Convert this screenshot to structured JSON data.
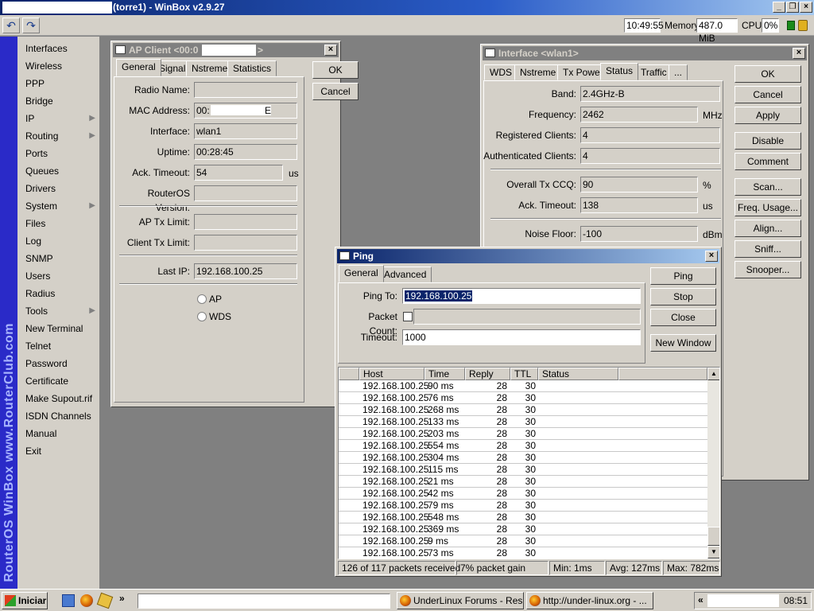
{
  "app": {
    "title": "(torre1) - WinBox v2.9.27"
  },
  "toolbar": {
    "time": "10:49:55",
    "memory_label": "Memory:",
    "memory_value": "487.0 MiB",
    "cpu_label": "CPU:",
    "cpu_value": "0%"
  },
  "sidebar": {
    "brand": "RouterOS WinBox   www.RouterClub.com",
    "items": [
      {
        "label": "Interfaces",
        "submenu": false
      },
      {
        "label": "Wireless",
        "submenu": false
      },
      {
        "label": "PPP",
        "submenu": false
      },
      {
        "label": "Bridge",
        "submenu": false
      },
      {
        "label": "IP",
        "submenu": true
      },
      {
        "label": "Routing",
        "submenu": true
      },
      {
        "label": "Ports",
        "submenu": false
      },
      {
        "label": "Queues",
        "submenu": false
      },
      {
        "label": "Drivers",
        "submenu": false
      },
      {
        "label": "System",
        "submenu": true
      },
      {
        "label": "Files",
        "submenu": false
      },
      {
        "label": "Log",
        "submenu": false
      },
      {
        "label": "SNMP",
        "submenu": false
      },
      {
        "label": "Users",
        "submenu": false
      },
      {
        "label": "Radius",
        "submenu": false
      },
      {
        "label": "Tools",
        "submenu": true
      },
      {
        "label": "New Terminal",
        "submenu": false
      },
      {
        "label": "Telnet",
        "submenu": false
      },
      {
        "label": "Password",
        "submenu": false
      },
      {
        "label": "Certificate",
        "submenu": false
      },
      {
        "label": "Make Supout.rif",
        "submenu": false
      },
      {
        "label": "ISDN Channels",
        "submenu": false
      },
      {
        "label": "Manual",
        "submenu": false
      },
      {
        "label": "Exit",
        "submenu": false
      }
    ]
  },
  "ap_client": {
    "title": "AP Client <00:0",
    "title_suffix": ">",
    "tabs": [
      "General",
      "Signal",
      "Nstreme",
      "Statistics"
    ],
    "fields": {
      "radio_name": {
        "label": "Radio Name:",
        "value": ""
      },
      "mac_address": {
        "label": "MAC Address:",
        "value": "00:",
        "value_tail": "E"
      },
      "interface": {
        "label": "Interface:",
        "value": "wlan1"
      },
      "uptime": {
        "label": "Uptime:",
        "value": "00:28:45"
      },
      "ack_timeout": {
        "label": "Ack. Timeout:",
        "value": "54",
        "unit": "us"
      },
      "routeros_version": {
        "label": "RouterOS Version:",
        "value": ""
      },
      "ap_tx_limit": {
        "label": "AP Tx Limit:",
        "value": ""
      },
      "client_tx_limit": {
        "label": "Client Tx Limit:",
        "value": ""
      },
      "last_ip": {
        "label": "Last IP:",
        "value": "192.168.100.25"
      }
    },
    "radio_ap": "AP",
    "radio_wds": "WDS",
    "ok": "OK",
    "cancel": "Cancel"
  },
  "interface": {
    "title": "Interface <wlan1>",
    "tabs": [
      "WDS",
      "Nstreme",
      "Tx Power",
      "Status",
      "Traffic",
      "..."
    ],
    "fields": {
      "band": {
        "label": "Band:",
        "value": "2.4GHz-B"
      },
      "frequency": {
        "label": "Frequency:",
        "value": "2462",
        "unit": "MHz"
      },
      "registered_clients": {
        "label": "Registered Clients:",
        "value": "4"
      },
      "authenticated_clients": {
        "label": "Authenticated Clients:",
        "value": "4"
      },
      "overall_tx_ccq": {
        "label": "Overall Tx CCQ:",
        "value": "90",
        "unit": "%"
      },
      "ack_timeout": {
        "label": "Ack. Timeout:",
        "value": "138",
        "unit": "us"
      },
      "noise_floor": {
        "label": "Noise Floor:",
        "value": "-100",
        "unit": "dBm"
      }
    },
    "buttons": [
      "OK",
      "Cancel",
      "Apply",
      "Disable",
      "Comment",
      "Scan...",
      "Freq. Usage...",
      "Align...",
      "Sniff...",
      "Snooper..."
    ]
  },
  "ping": {
    "title": "Ping",
    "tabs": [
      "General",
      "Advanced"
    ],
    "ping_to_label": "Ping To:",
    "ping_to_value": "192.168.100.25",
    "packet_count_label": "Packet Count:",
    "timeout_label": "Timeout:",
    "timeout_value": "1000",
    "buttons": [
      "Ping",
      "Stop",
      "Close",
      "New Window"
    ],
    "columns": [
      "Host",
      "Time",
      "Reply Size",
      "TTL",
      "Status"
    ],
    "rows": [
      {
        "host": "192.168.100.25",
        "time": "90 ms",
        "size": "28",
        "ttl": "30"
      },
      {
        "host": "192.168.100.25",
        "time": "76 ms",
        "size": "28",
        "ttl": "30"
      },
      {
        "host": "192.168.100.25",
        "time": "268 ms",
        "size": "28",
        "ttl": "30"
      },
      {
        "host": "192.168.100.25",
        "time": "133 ms",
        "size": "28",
        "ttl": "30"
      },
      {
        "host": "192.168.100.25",
        "time": "203 ms",
        "size": "28",
        "ttl": "30"
      },
      {
        "host": "192.168.100.25",
        "time": "554 ms",
        "size": "28",
        "ttl": "30"
      },
      {
        "host": "192.168.100.25",
        "time": "304 ms",
        "size": "28",
        "ttl": "30"
      },
      {
        "host": "192.168.100.25",
        "time": "115 ms",
        "size": "28",
        "ttl": "30"
      },
      {
        "host": "192.168.100.25",
        "time": "21 ms",
        "size": "28",
        "ttl": "30"
      },
      {
        "host": "192.168.100.25",
        "time": "42 ms",
        "size": "28",
        "ttl": "30"
      },
      {
        "host": "192.168.100.25",
        "time": "79 ms",
        "size": "28",
        "ttl": "30"
      },
      {
        "host": "192.168.100.25",
        "time": "548 ms",
        "size": "28",
        "ttl": "30"
      },
      {
        "host": "192.168.100.25",
        "time": "369 ms",
        "size": "28",
        "ttl": "30"
      },
      {
        "host": "192.168.100.25",
        "time": "9 ms",
        "size": "28",
        "ttl": "30"
      },
      {
        "host": "192.168.100.25",
        "time": "73 ms",
        "size": "28",
        "ttl": "30"
      }
    ],
    "status": {
      "received": "126 of 117 packets received",
      "gain": "7% packet gain",
      "min": "Min: 1ms",
      "avg": "Avg: 127ms",
      "max": "Max: 782ms"
    }
  },
  "taskbar": {
    "start": "Iniciar",
    "tasks": [
      "UnderLinux Forums - Res...",
      "http://under-linux.org - ..."
    ],
    "clock": "08:51"
  }
}
